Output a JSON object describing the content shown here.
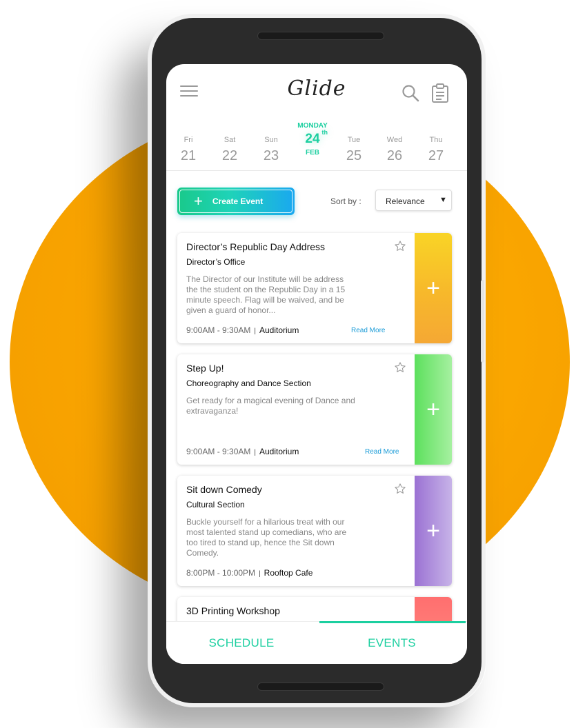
{
  "app": {
    "name": "Glide"
  },
  "header": {
    "menu_icon": "hamburger-icon",
    "search_icon": "search-icon",
    "clipboard_icon": "clipboard-icon"
  },
  "dates": {
    "selected_day_label": "MONDAY",
    "days": [
      {
        "dow": "Fri",
        "date": "21"
      },
      {
        "dow": "Sat",
        "date": "22"
      },
      {
        "dow": "Sun",
        "date": "23"
      },
      {
        "dow": "",
        "date": "24",
        "suffix": "th",
        "month": "FEB"
      },
      {
        "dow": "Tue",
        "date": "25"
      },
      {
        "dow": "Wed",
        "date": "26"
      },
      {
        "dow": "Thu",
        "date": "27"
      }
    ]
  },
  "toolbar": {
    "create_label": "Create Event",
    "sort_label": "Sort by :",
    "sort_value": "Relevance"
  },
  "events": [
    {
      "title": "Director’s Republic Day Address",
      "org": "Director’s Office",
      "desc": "The Director of our Institute will be address the the student on the Republic Day in a 15 minute speech. Flag will be waived, and be given a guard of honor...",
      "time": "9:00AM - 9:30AM",
      "venue": "Auditorium",
      "read_more": "Read More"
    },
    {
      "title": "Step Up!",
      "org": "Choreography and Dance Section",
      "desc": "Get ready for a magical evening of Dance and extravaganza!",
      "time": "9:00AM - 9:30AM",
      "venue": "Auditorium",
      "read_more": "Read More"
    },
    {
      "title": "Sit down Comedy",
      "org": "Cultural Section",
      "desc": "Buckle yourself for a hilarious treat with our most talented stand up comedians, who are too tired to stand up, hence the Sit down Comedy.",
      "time": "8:00PM - 10:00PM",
      "venue": "Rooftop Cafe"
    },
    {
      "title": "3D Printing Workshop"
    }
  ],
  "nav": {
    "schedule": "SCHEDULE",
    "events": "EVENTS"
  },
  "colors": {
    "accent": "#1ccfa0",
    "link": "#1a9bd7",
    "blob": "#f9a400"
  }
}
